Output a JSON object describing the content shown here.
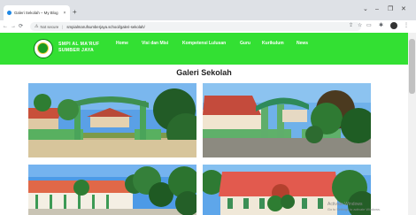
{
  "browser": {
    "tab_title": "Galeri Sekolah – My Blog",
    "tab_close": "×",
    "new_tab": "+",
    "window_controls": [
      "⌄",
      "–",
      "❐",
      "✕"
    ],
    "nav_icons": [
      "back-icon",
      "forward-icon",
      "reload-icon"
    ],
    "nav_glyphs": [
      "←",
      "→",
      "⟳"
    ],
    "security_label": "Not secure",
    "url": "smpialmarufsumberjaya.school/galeri-sekolah/",
    "toolbar_icons": [
      "share-icon",
      "bookmark-star-icon",
      "tab-search-icon",
      "extensions-icon",
      "menu-icon"
    ],
    "toolbar_glyphs": [
      "⇪",
      "☆",
      "▭",
      "✱",
      "⋮"
    ]
  },
  "site": {
    "brand_line1": "SMPI AL MA'RUF",
    "brand_line2": "SUMBER JAYA",
    "menu": [
      "Home",
      "Visi dan Misi",
      "Kompetensi Lulusan",
      "Guru",
      "Kurikulum",
      "News"
    ],
    "header_color": "#33e033"
  },
  "gallery": {
    "title": "Galeri Sekolah",
    "photos": [
      {
        "subject": "school-gate"
      },
      {
        "subject": "school-yard"
      },
      {
        "subject": "classroom-building"
      },
      {
        "subject": "red-roof-building"
      }
    ]
  },
  "os_watermark": {
    "line1": "Activate Windows",
    "line2": "Go to Settings to activate Windows."
  }
}
